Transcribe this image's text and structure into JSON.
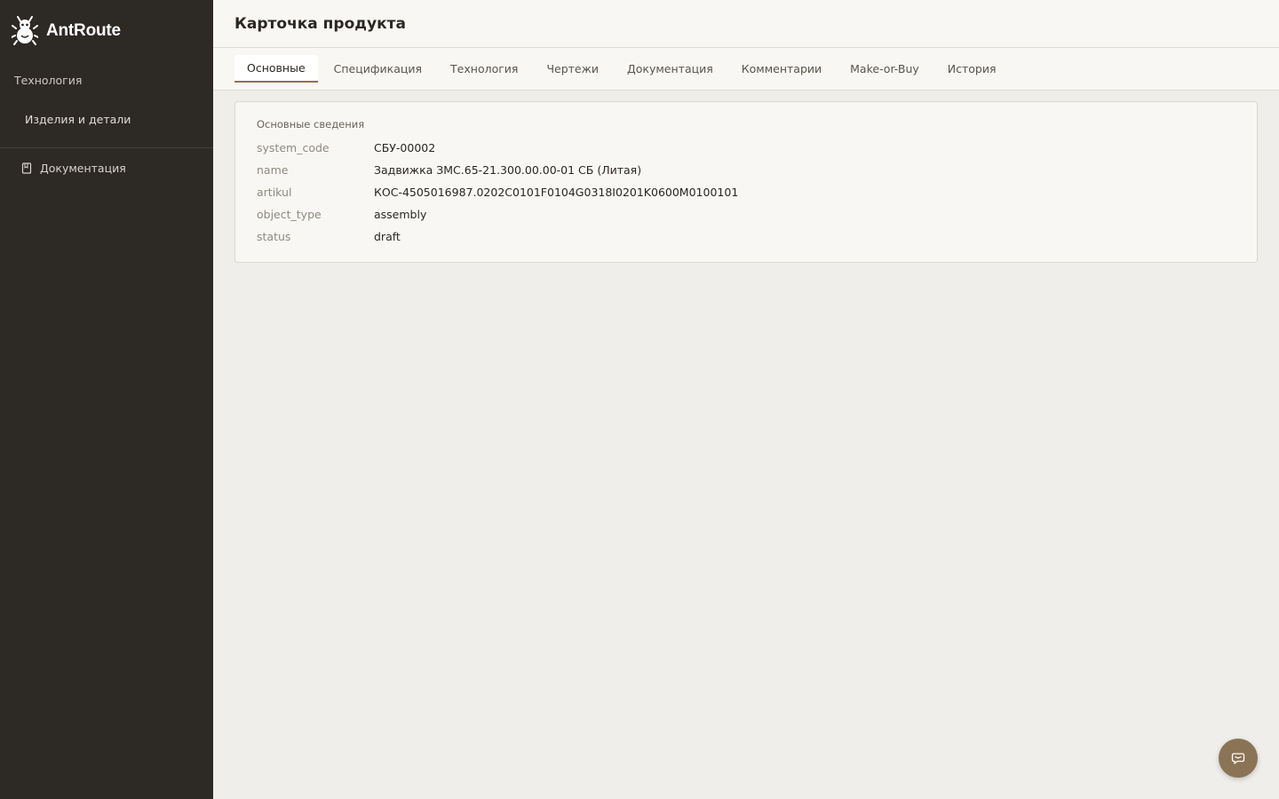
{
  "brand": {
    "name": "AntRoute"
  },
  "sidebar": {
    "section_label": "Технология",
    "items": [
      {
        "label": "Изделия и детали"
      }
    ],
    "doc_link": {
      "label": "Документация",
      "icon": "book-icon"
    }
  },
  "header": {
    "title": "Карточка продукта"
  },
  "tabs": [
    {
      "label": "Основные",
      "active": true
    },
    {
      "label": "Спецификация"
    },
    {
      "label": "Технология"
    },
    {
      "label": "Чертежи"
    },
    {
      "label": "Документация"
    },
    {
      "label": "Комментарии"
    },
    {
      "label": "Make-or-Buy"
    },
    {
      "label": "История"
    }
  ],
  "card": {
    "title": "Основные сведения",
    "fields": [
      {
        "key": "system_code",
        "value": "СБУ-00002"
      },
      {
        "key": "name",
        "value": "Задвижка ЗМС.65-21.300.00.00-01 СБ (Литая)"
      },
      {
        "key": "artikul",
        "value": "КОС-4505016987.0202C0101F0104G0318I0201K0600M0100101"
      },
      {
        "key": "object_type",
        "value": "assembly"
      },
      {
        "key": "status",
        "value": "draft"
      }
    ]
  },
  "colors": {
    "sidebar_bg": "#2d2925",
    "accent": "#8b7355",
    "page_bg": "#efeeea"
  },
  "chat_button": {
    "icon": "chat-icon"
  }
}
